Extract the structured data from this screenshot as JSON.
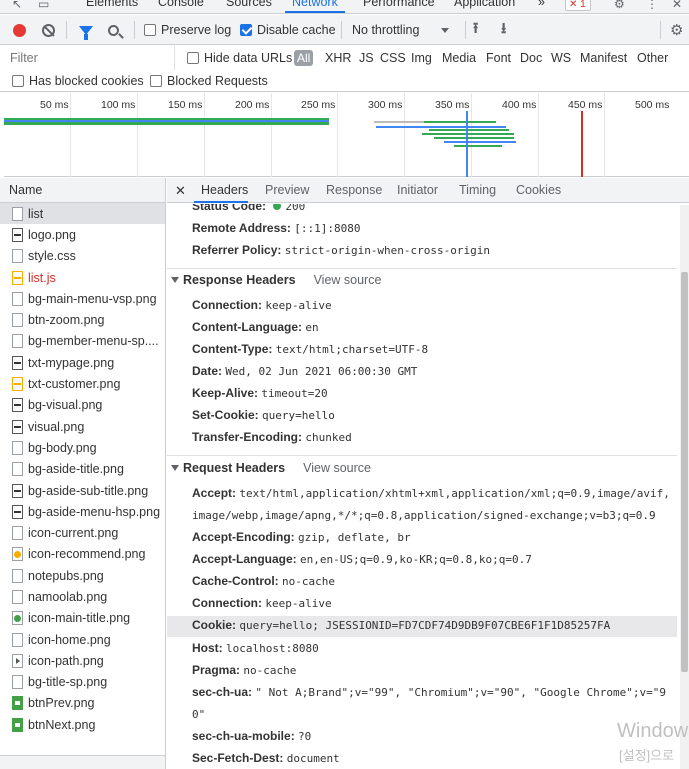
{
  "panel_tabs": {
    "elements": "Elements",
    "console": "Console",
    "sources": "Sources",
    "network": "Network",
    "performance": "Performance",
    "application": "Application",
    "more": "»",
    "error_count": "1"
  },
  "toolbar": {
    "preserve_log": "Preserve log",
    "preserve_log_checked": false,
    "disable_cache": "Disable cache",
    "disable_cache_checked": true,
    "throttling": "No throttling"
  },
  "filter": {
    "placeholder": "Filter",
    "hide_data_urls": "Hide data URLs",
    "types": [
      "All",
      "XHR",
      "JS",
      "CSS",
      "Img",
      "Media",
      "Font",
      "Doc",
      "WS",
      "Manifest",
      "Other"
    ],
    "has_blocked_cookies": "Has blocked cookies",
    "blocked_requests": "Blocked Requests"
  },
  "overview": {
    "ticks": [
      "50 ms",
      "100 ms",
      "150 ms",
      "200 ms",
      "250 ms",
      "300 ms",
      "350 ms",
      "400 ms",
      "450 ms",
      "500 ms"
    ],
    "colors": {
      "blue": "#4285f4",
      "green": "#34a853",
      "red": "#d93025"
    }
  },
  "name_column": {
    "header": "Name",
    "rows": [
      {
        "name": "list",
        "icon": "document-icon",
        "selected": true
      },
      {
        "name": "logo.png",
        "icon": "image-icon"
      },
      {
        "name": "style.css",
        "icon": "stylesheet-icon"
      },
      {
        "name": "list.js",
        "icon": "script-icon",
        "error": true
      },
      {
        "name": "bg-main-menu-vsp.png",
        "icon": "image-icon"
      },
      {
        "name": "btn-zoom.png",
        "icon": "image-icon"
      },
      {
        "name": "bg-member-menu-sp....",
        "icon": "image-icon"
      },
      {
        "name": "txt-mypage.png",
        "icon": "image-icon"
      },
      {
        "name": "txt-customer.png",
        "icon": "image-icon"
      },
      {
        "name": "bg-visual.png",
        "icon": "image-icon"
      },
      {
        "name": "visual.png",
        "icon": "image-icon"
      },
      {
        "name": "bg-body.png",
        "icon": "image-icon"
      },
      {
        "name": "bg-aside-title.png",
        "icon": "image-icon"
      },
      {
        "name": "bg-aside-sub-title.png",
        "icon": "image-icon"
      },
      {
        "name": "bg-aside-menu-hsp.png",
        "icon": "image-icon"
      },
      {
        "name": "icon-current.png",
        "icon": "image-icon"
      },
      {
        "name": "icon-recommend.png",
        "icon": "image-icon"
      },
      {
        "name": "notepubs.png",
        "icon": "image-icon"
      },
      {
        "name": "namoolab.png",
        "icon": "image-icon"
      },
      {
        "name": "icon-main-title.png",
        "icon": "image-icon"
      },
      {
        "name": "icon-home.png",
        "icon": "image-icon"
      },
      {
        "name": "icon-path.png",
        "icon": "image-icon"
      },
      {
        "name": "bg-title-sp.png",
        "icon": "image-icon"
      },
      {
        "name": "btnPrev.png",
        "icon": "image-icon"
      },
      {
        "name": "btnNext.png",
        "icon": "image-icon"
      }
    ]
  },
  "detail_tabs": [
    "Headers",
    "Preview",
    "Response",
    "Initiator",
    "Timing",
    "Cookies"
  ],
  "general": {
    "status_code_label": "Status Code:",
    "status_code_value": "200",
    "remote_address_label": "Remote Address:",
    "remote_address_value": "[::1]:8080",
    "referrer_policy_label": "Referrer Policy:",
    "referrer_policy_value": "strict-origin-when-cross-origin"
  },
  "response_headers": {
    "title": "Response Headers",
    "view_source": "View source",
    "items": [
      {
        "k": "Connection:",
        "v": "keep-alive"
      },
      {
        "k": "Content-Language:",
        "v": "en"
      },
      {
        "k": "Content-Type:",
        "v": "text/html;charset=UTF-8"
      },
      {
        "k": "Date:",
        "v": "Wed, 02 Jun 2021 06:00:30 GMT"
      },
      {
        "k": "Keep-Alive:",
        "v": "timeout=20"
      },
      {
        "k": "Set-Cookie:",
        "v": "query=hello"
      },
      {
        "k": "Transfer-Encoding:",
        "v": "chunked"
      }
    ]
  },
  "request_headers": {
    "title": "Request Headers",
    "view_source": "View source",
    "accept_label": "Accept:",
    "accept_line1": "text/html,application/xhtml+xml,application/xml;q=0.9,image/avif,",
    "accept_line2": "image/webp,image/apng,*/*;q=0.8,application/signed-exchange;v=b3;q=0.9",
    "accept_encoding_label": "Accept-Encoding:",
    "accept_encoding_value": "gzip, deflate, br",
    "accept_language_label": "Accept-Language:",
    "accept_language_value": "en,en-US;q=0.9,ko-KR;q=0.8,ko;q=0.7",
    "cache_control_label": "Cache-Control:",
    "cache_control_value": "no-cache",
    "connection_label": "Connection:",
    "connection_value": "keep-alive",
    "cookie_label": "Cookie:",
    "cookie_value": "query=hello; JSESSIONID=FD7CDF74D9DB9F07CBE6F1F1D85257FA",
    "host_label": "Host:",
    "host_value": "localhost:8080",
    "pragma_label": "Pragma:",
    "pragma_value": "no-cache",
    "sec_ch_ua_label": "sec-ch-ua:",
    "sec_ch_ua_line1": "\" Not A;Brand\";v=\"99\", \"Chromium\";v=\"90\", \"Google Chrome\";v=\"9",
    "sec_ch_ua_line2": "0\"",
    "sec_ch_ua_mobile_label": "sec-ch-ua-mobile:",
    "sec_ch_ua_mobile_value": "?0",
    "sec_fetch_dest_label": "Sec-Fetch-Dest:",
    "sec_fetch_dest_value": "document"
  },
  "watermark": {
    "line1": "Window",
    "line2": "[설정]으로"
  }
}
